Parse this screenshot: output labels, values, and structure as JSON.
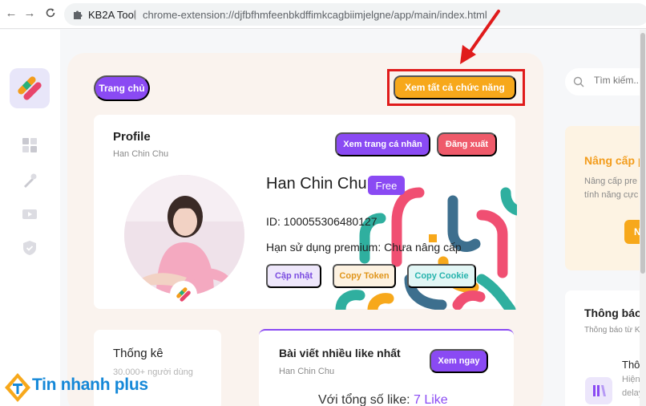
{
  "browser": {
    "extension_name": "KB2A Tool",
    "separator": "|",
    "url": "chrome-extension://djfbfhmfeenbkdffimkcagbiimjelgne/app/main/index.html"
  },
  "nav": {
    "home_label": "Trang chủ",
    "all_features_label": "Xem tất cả chức năng"
  },
  "profile": {
    "title": "Profile",
    "subtitle": "Han Chin Chu",
    "view_profile_label": "Xem trang cá nhân",
    "logout_label": "Đăng xuất",
    "name": "Han Chin Chu",
    "plan": "Free",
    "id_line": "ID: 100055306480127",
    "premium_line": "Hạn sử dụng premium: Chưa nâng cấp",
    "update_label": "Cập nhật",
    "copy_token_label": "Copy Token",
    "copy_cookie_label": "Copy Cookie"
  },
  "stats": {
    "title": "Thống kê",
    "subtitle": "30.000+ người dùng"
  },
  "top_posts": {
    "title": "Bài viết nhiều like nhất",
    "subtitle": "Han Chin Chu",
    "see_now_label": "Xem ngay",
    "summary_prefix": "Với tổng số like:",
    "summary_value": "7 Like"
  },
  "sidebar_right": {
    "search_placeholder": "Tìm kiếm...",
    "upgrade_title": "Nâng cấp pre",
    "upgrade_text_1": "Nâng cấp pre",
    "upgrade_text_2": "tính năng cực",
    "upgrade_button_label": "Nâ",
    "notice_title": "Thông báo",
    "notice_sub": "Thông báo từ K",
    "notice_item_title": "Thôn",
    "notice_item_line1": "Hiện",
    "notice_item_line2": "delay"
  },
  "watermark": {
    "text": "Tin nhanh plus"
  },
  "colors": {
    "accent_purple": "#8a4af3",
    "accent_orange": "#f7a81b",
    "logout_red": "#ef5a6a",
    "highlight_red": "#e01b1b"
  }
}
